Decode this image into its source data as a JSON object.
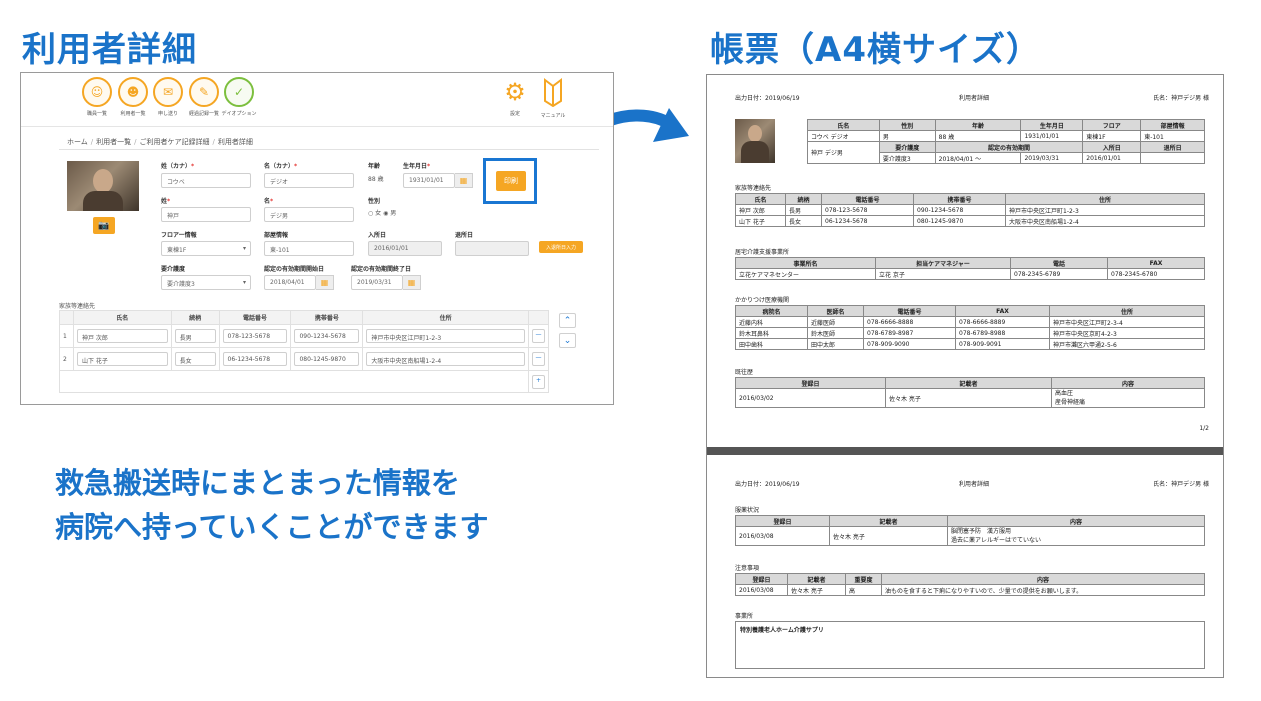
{
  "headings": {
    "left": "利用者詳細",
    "right": "帳票（A4横サイズ）",
    "tagline_line1": "救急搬送時にまとまった情報を",
    "tagline_line2": "病院へ持っていくことができます"
  },
  "colors": {
    "accent": "#1a73c9",
    "orange": "#f5a623",
    "green": "#7cbf3e"
  },
  "app": {
    "nav": [
      {
        "label": "職員一覧",
        "icon": "staff-icon"
      },
      {
        "label": "利用者一覧",
        "icon": "user-icon"
      },
      {
        "label": "申し送り",
        "icon": "handover-icon"
      },
      {
        "label": "経過記録一覧",
        "icon": "record-icon"
      },
      {
        "label": "デイオプション",
        "icon": "book-icon"
      }
    ],
    "settings_label": "設定",
    "manual_label": "マニュアル",
    "breadcrumb": [
      "ホーム",
      "利用者一覧",
      "ご利用者ケア記録詳細",
      "利用者詳細"
    ],
    "form": {
      "sei_kana_label": "姓（カナ）",
      "sei_kana": "コウベ",
      "mei_kana_label": "名（カナ）",
      "mei_kana": "デジオ",
      "age_label": "年齢",
      "age": "88 歳",
      "birth_label": "生年月日",
      "birth": "1931/01/01",
      "sei_label": "姓",
      "sei": "神戸",
      "mei_label": "名",
      "mei": "デジ男",
      "gender_label": "性別",
      "gender_female": "女",
      "gender_male": "男",
      "floor_label": "フロアー情報",
      "floor": "東棟1F",
      "room_label": "部屋情報",
      "room": "東-101",
      "admit_label": "入所日",
      "admit": "2016/01/01",
      "discharge_label": "退所日",
      "care_label": "要介護度",
      "care": "要介護度3",
      "valid_start_label": "認定の有効期間開始日",
      "valid_start": "2018/04/01",
      "valid_end_label": "認定の有効期間終了日",
      "valid_end": "2019/03/31",
      "print_label": "印刷",
      "admit_button_label": "入退所日入力"
    },
    "family_section_label": "家族等連絡先",
    "family_headers": [
      "氏名",
      "続柄",
      "電話番号",
      "携帯番号",
      "住所"
    ],
    "family_rows": [
      {
        "no": "1",
        "name": "神戸 次郎",
        "rel": "長男",
        "tel": "078-123-5678",
        "mobile": "090-1234-5678",
        "address": "神戸市中央区江戸町1-2-3"
      },
      {
        "no": "2",
        "name": "山下 花子",
        "rel": "長女",
        "tel": "06-1234-5678",
        "mobile": "080-1245-9870",
        "address": "大阪市中央区南船場1-2-4"
      }
    ]
  },
  "doc": {
    "print_date": "出力日付：2019/06/19",
    "doc_title": "利用者詳細",
    "patient": "氏名：神戸デジ男 様",
    "basic_headers1": [
      "氏名",
      "性別",
      "年齢",
      "生年月日",
      "フロア",
      "部屋情報"
    ],
    "basic_row1": [
      "コウベ デジオ",
      "男",
      "88 歳",
      "1931/01/01",
      "東棟1F",
      "東-101"
    ],
    "basic_headers2": [
      "要介護度",
      "認定の有効期間",
      "入所日",
      "退所日"
    ],
    "basic_row2": [
      "神戸 デジ男",
      "要介護度3",
      "2018/04/01 〜",
      "2019/03/31",
      "2016/01/01",
      ""
    ],
    "family_label": "家族等連絡先",
    "family_headers": [
      "氏名",
      "続柄",
      "電話番号",
      "携帯番号",
      "住所"
    ],
    "family_rows": [
      [
        "神戸 次郎",
        "長男",
        "078-123-5678",
        "090-1234-5678",
        "神戸市中央区江戸町1-2-3"
      ],
      [
        "山下 花子",
        "長女",
        "06-1234-5678",
        "080-1245-9870",
        "大阪市中央区南船場1-2-4"
      ]
    ],
    "care_office_label": "居宅介護支援事業所",
    "care_office_headers": [
      "事業所名",
      "担当ケアマネジャー",
      "電話",
      "FAX"
    ],
    "care_office_row": [
      "立花ケアマネセンター",
      "立花 京子",
      "078-2345-6789",
      "078-2345-6780"
    ],
    "clinic_label": "かかりつけ医療機関",
    "clinic_headers": [
      "病院名",
      "医師名",
      "電話番号",
      "FAX",
      "住所"
    ],
    "clinic_rows": [
      [
        "近藤内科",
        "近藤医師",
        "078-6666-8888",
        "078-6666-8889",
        "神戸市中央区江戸町2-3-4"
      ],
      [
        "鈴木耳鼻科",
        "鈴木医師",
        "078-6789-8987",
        "078-6789-8988",
        "神戸市中央区京町4-2-3"
      ],
      [
        "田中歯科",
        "田中太郎",
        "078-909-9090",
        "078-909-9091",
        "神戸市灘区六甲通2-5-6"
      ]
    ],
    "history_label": "既往歴",
    "history_headers": [
      "登録日",
      "記載者",
      "内容"
    ],
    "history_row": {
      "date": "2016/03/02",
      "author": "佐々木 亮子",
      "content1": "高血圧",
      "content2": "産骨神経痛"
    },
    "page_num": "1/2",
    "meds_label": "服薬状況",
    "meds_headers": [
      "登録日",
      "記載者",
      "内容"
    ],
    "meds_row": {
      "date": "2016/03/08",
      "author": "佐々木 亮子",
      "content1": "脳閉塞予防　漢方服用",
      "content2": "過去に薬アレルギーはでていない"
    },
    "notes_label": "注意事項",
    "notes_headers": [
      "登録日",
      "記載者",
      "重要度",
      "内容"
    ],
    "notes_row": [
      "2016/03/08",
      "佐々木 亮子",
      "高",
      "油ものを食すると下痢になりやすいので、少量での提供をお願いします。"
    ],
    "office_label": "事業所",
    "office_name": "特別養護老人ホーム介護サプリ"
  }
}
